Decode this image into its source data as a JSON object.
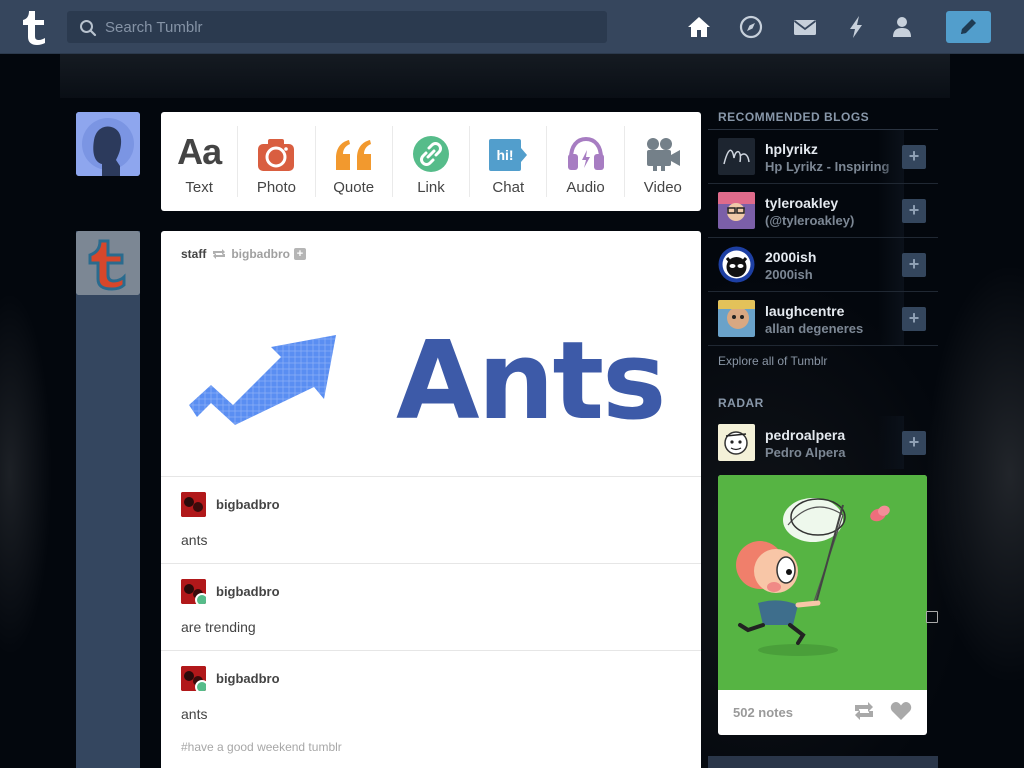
{
  "header": {
    "search_placeholder": "Search Tumblr",
    "nav": [
      "home-icon",
      "explore-compass-icon",
      "inbox-envelope-icon",
      "activity-lightning-icon",
      "account-person-icon"
    ],
    "compose_icon": "pencil-icon"
  },
  "post_types": [
    {
      "label": "Text",
      "icon": "text-icon",
      "color": "#444444"
    },
    {
      "label": "Photo",
      "icon": "camera-icon",
      "color": "#d95e40"
    },
    {
      "label": "Quote",
      "icon": "quote-icon",
      "color": "#f2992e"
    },
    {
      "label": "Link",
      "icon": "link-icon",
      "color": "#56bc8a"
    },
    {
      "label": "Chat",
      "icon": "chat-icon",
      "color": "#529ecc"
    },
    {
      "label": "Audio",
      "icon": "headphones-icon",
      "color": "#a77dc2"
    },
    {
      "label": "Video",
      "icon": "video-camera-icon",
      "color": "#748089"
    }
  ],
  "post": {
    "author": "staff",
    "reblogged_from": "bigbadbro",
    "image_text": "Ants",
    "thread": [
      {
        "name": "bigbadbro",
        "text": "ants",
        "reblog": false
      },
      {
        "name": "bigbadbro",
        "text": "are trending",
        "reblog": true
      },
      {
        "name": "bigbadbro",
        "text": "ants",
        "reblog": true
      }
    ],
    "tag": "#have a good weekend tumblr"
  },
  "sidebar": {
    "recommended_title": "RECOMMENDED BLOGS",
    "blogs": [
      {
        "name": "hplyrikz",
        "desc": "Hp Lyrikz - Inspiring"
      },
      {
        "name": "tyleroakley",
        "desc": "(@tyleroakley)"
      },
      {
        "name": "2000ish",
        "desc": "2000ish"
      },
      {
        "name": "laughcentre",
        "desc": "allan degeneres"
      }
    ],
    "explore_label": "Explore all of Tumblr",
    "radar_title": "RADAR",
    "radar": {
      "name": "pedroalpera",
      "desc": "Pedro Alpera",
      "notes": "502 notes"
    }
  },
  "colors": {
    "header": "#36465d",
    "accent": "#529ecc",
    "radar_bg": "#56b443"
  }
}
